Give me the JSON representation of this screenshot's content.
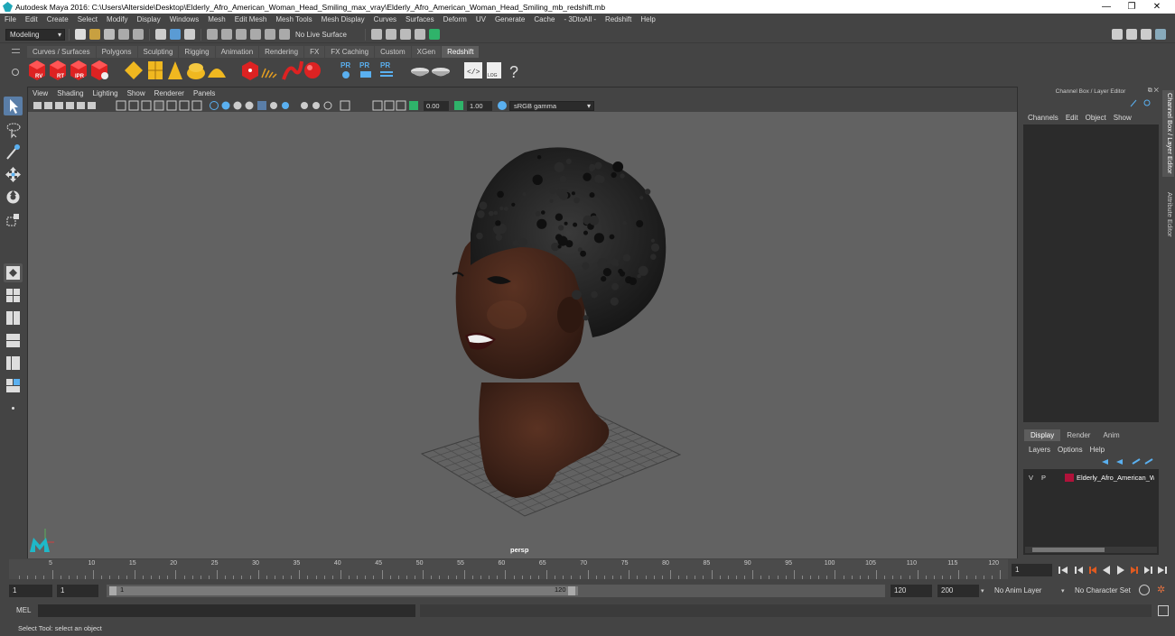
{
  "window": {
    "title": "Autodesk Maya 2016: C:\\Users\\Alterside\\Desktop\\Elderly_Afro_American_Woman_Head_Smiling_max_vray\\Elderly_Afro_American_Woman_Head_Smiling_mb_redshift.mb",
    "minimize": "—",
    "restore": "❐",
    "close": "✕"
  },
  "menu": [
    "File",
    "Edit",
    "Create",
    "Select",
    "Modify",
    "Display",
    "Windows",
    "Mesh",
    "Edit Mesh",
    "Mesh Tools",
    "Mesh Display",
    "Curves",
    "Surfaces",
    "Deform",
    "UV",
    "Generate",
    "Cache",
    "- 3DtoAll -",
    "Redshift",
    "Help"
  ],
  "statusline": {
    "mode": "Modeling",
    "live_surface": "No Live Surface"
  },
  "shelf_tabs": [
    "Curves / Surfaces",
    "Polygons",
    "Sculpting",
    "Rigging",
    "Animation",
    "Rendering",
    "FX",
    "FX Caching",
    "Custom",
    "XGen",
    "Redshift"
  ],
  "shelf_active": "Redshift",
  "shelf_icons": [
    {
      "name": "redshift-rv-icon",
      "label": "RV"
    },
    {
      "name": "redshift-rt-icon",
      "label": "RT"
    },
    {
      "name": "redshift-ipr-icon",
      "label": "IPR"
    },
    {
      "name": "redshift-settings-icon",
      "label": ""
    },
    {
      "name": "redshift-light-1-icon",
      "label": ""
    },
    {
      "name": "redshift-light-2-icon",
      "label": ""
    },
    {
      "name": "redshift-light-3-icon",
      "label": ""
    },
    {
      "name": "redshift-light-4-icon",
      "label": ""
    },
    {
      "name": "redshift-dome-icon",
      "label": ""
    },
    {
      "name": "redshift-cube-icon",
      "label": ""
    },
    {
      "name": "redshift-volume-icon",
      "label": ""
    },
    {
      "name": "redshift-curve-icon",
      "label": ""
    },
    {
      "name": "redshift-sphere-icon",
      "label": ""
    },
    {
      "name": "redshift-pr-1-icon",
      "label": "PR"
    },
    {
      "name": "redshift-pr-2-icon",
      "label": "PR"
    },
    {
      "name": "redshift-pr-3-icon",
      "label": "PR"
    },
    {
      "name": "redshift-bowl-1-icon",
      "label": ""
    },
    {
      "name": "redshift-bowl-2-icon",
      "label": ""
    },
    {
      "name": "redshift-code-icon",
      "label": ""
    },
    {
      "name": "redshift-log-icon",
      "label": "LOG"
    },
    {
      "name": "help-icon",
      "label": "?"
    }
  ],
  "viewport": {
    "menu": [
      "View",
      "Shading",
      "Lighting",
      "Show",
      "Renderer",
      "Panels"
    ],
    "exposure": "0.00",
    "gamma": "1.00",
    "colorspace": "sRGB gamma",
    "camera": "persp"
  },
  "channel_box": {
    "title": "Channel Box / Layer Editor",
    "menu": [
      "Channels",
      "Edit",
      "Object",
      "Show"
    ]
  },
  "layer_editor": {
    "tabs": [
      "Display",
      "Render",
      "Anim"
    ],
    "active_tab": "Display",
    "menu": [
      "Layers",
      "Options",
      "Help"
    ],
    "layers": [
      {
        "v": "V",
        "p": "P",
        "color": "#b0123a",
        "name": "Elderly_Afro_American_W"
      }
    ]
  },
  "side_tabs": [
    "Channel Box / Layer Editor",
    "Attribute Editor"
  ],
  "timeline": {
    "ticks": [
      "5",
      "10",
      "15",
      "20",
      "25",
      "30",
      "35",
      "40",
      "45",
      "50",
      "55",
      "60",
      "65",
      "70",
      "75",
      "80",
      "85",
      "90",
      "95",
      "100",
      "105",
      "110",
      "115",
      "120"
    ],
    "start_marker": "1",
    "current_frame": "1"
  },
  "range": {
    "start": "1",
    "anim_start": "1",
    "slider_start": "1",
    "slider_end": "120",
    "anim_end": "120",
    "end": "200",
    "anim_layer": "No Anim Layer",
    "character_set": "No Character Set"
  },
  "command_line": {
    "label": "MEL"
  },
  "help_line": "Select Tool: select an object"
}
